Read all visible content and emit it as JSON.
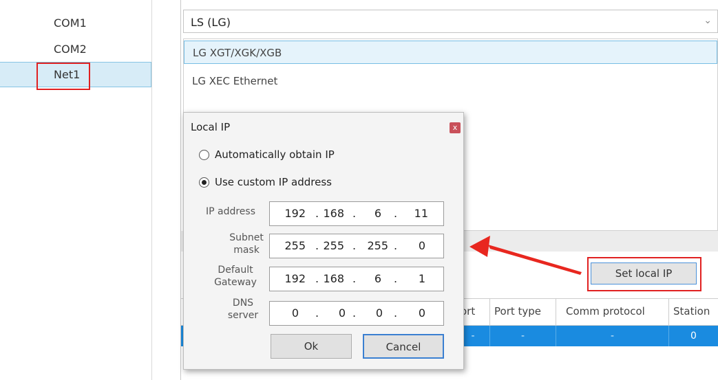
{
  "nav": {
    "items": [
      {
        "label": "COM1"
      },
      {
        "label": "COM2"
      },
      {
        "label": "Net1"
      }
    ]
  },
  "brand": {
    "combo_value": "LS (LG)"
  },
  "models": [
    {
      "label": "LG XGT/XGK/XGB"
    },
    {
      "label": "LG XEC Ethernet"
    }
  ],
  "set_local_ip_button": "Set local IP",
  "table": {
    "headers": [
      "ort",
      "Port type",
      "Comm protocol",
      "Station"
    ],
    "row": [
      "-",
      "-",
      "-",
      "0"
    ]
  },
  "dialog": {
    "title": "Local IP",
    "close": "x",
    "radio_auto": "Automatically obtain IP",
    "radio_custom": "Use custom IP address",
    "selected_mode": "custom",
    "fields": [
      {
        "label": "IP address",
        "octets": [
          "192",
          "168",
          "6",
          "11"
        ]
      },
      {
        "label": "Subnet mask",
        "octets": [
          "255",
          "255",
          "255",
          "0"
        ]
      },
      {
        "label": "Default Gateway",
        "octets": [
          "192",
          "168",
          "6",
          "1"
        ]
      },
      {
        "label": "DNS server",
        "octets": [
          "0",
          "0",
          "0",
          "0"
        ]
      }
    ],
    "dot": ".",
    "ok": "Ok",
    "cancel": "Cancel"
  },
  "annotation": {
    "highlight_color": "#e02020"
  },
  "colors": {
    "selection_blue": "#1a8be0",
    "list_selected": "#e5f3fb",
    "accent": "#3a7fd1"
  }
}
